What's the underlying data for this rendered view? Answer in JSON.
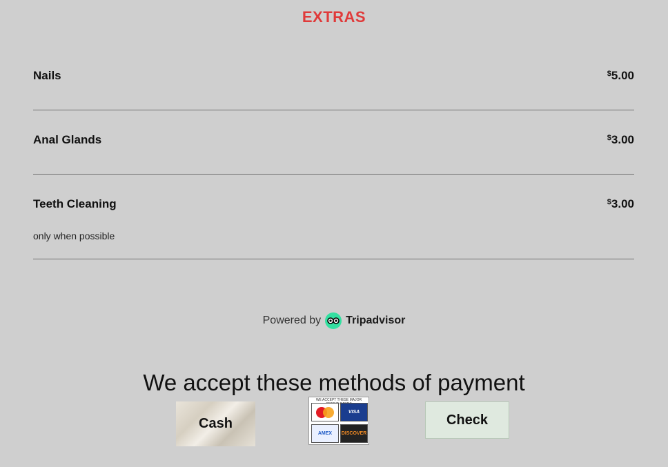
{
  "section": {
    "title": "EXTRAS"
  },
  "items": [
    {
      "name": "Nails",
      "currency": "$",
      "price": "5.00",
      "note": ""
    },
    {
      "name": "Anal Glands",
      "currency": "$",
      "price": "3.00",
      "note": ""
    },
    {
      "name": "Teeth Cleaning",
      "currency": "$",
      "price": "3.00",
      "note": "only when possible"
    }
  ],
  "powered": {
    "prefix": "Powered by",
    "brand": "Tripadvisor",
    "icon": "owl-eyes-icon",
    "brand_color": "#34e0a1"
  },
  "payment": {
    "title": "We accept these methods of payment",
    "cash_label": "Cash",
    "check_label": "Check",
    "cards_caption": "WE ACCEPT THESE MAJOR CREDIT CARDS",
    "cards": [
      "MasterCard",
      "VISA",
      "American Express",
      "DISCOVER"
    ]
  },
  "colors": {
    "background": "#cfcfcf",
    "accent": "#e03a3a"
  }
}
